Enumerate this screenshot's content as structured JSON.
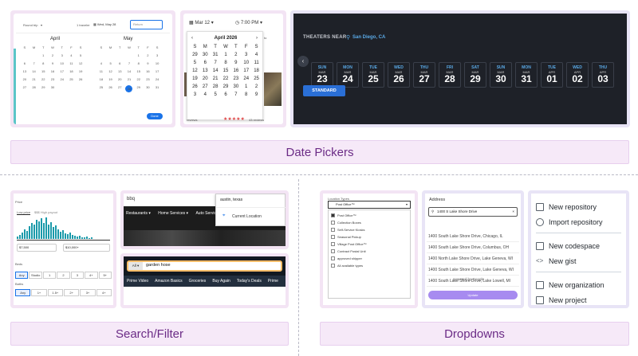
{
  "sections": {
    "date_pickers": "Date Pickers",
    "search_filter": "Search/Filter",
    "dropdowns": "Dropdowns"
  },
  "flight_picker": {
    "trip_type": "Round trip",
    "travelers": "1 traveler",
    "depart_value": "Wed, May 28",
    "return_placeholder": "Return",
    "month1": "April",
    "month2": "May",
    "weekdays": [
      "S",
      "M",
      "T",
      "W",
      "T",
      "F",
      "S"
    ],
    "april_days": [
      "",
      "",
      "1",
      "2",
      "3",
      "4",
      "5",
      "6",
      "7",
      "8",
      "9",
      "10",
      "11",
      "12",
      "13",
      "14",
      "15",
      "16",
      "17",
      "18",
      "19",
      "20",
      "21",
      "22",
      "23",
      "24",
      "25",
      "26",
      "27",
      "28",
      "29",
      "30",
      "",
      "",
      ""
    ],
    "may_days": [
      "",
      "",
      "",
      "",
      "1",
      "2",
      "3",
      "4",
      "5",
      "6",
      "7",
      "8",
      "9",
      "10",
      "11",
      "12",
      "13",
      "14",
      "15",
      "16",
      "17",
      "18",
      "19",
      "20",
      "21",
      "22",
      "23",
      "24",
      "25",
      "26",
      "27",
      "28",
      "29",
      "30",
      "31"
    ],
    "selected_day": "28",
    "done_label": "Done"
  },
  "event_picker": {
    "date_value": "Mar 12",
    "time_value": "7:00 PM",
    "month_title": "April 2026",
    "weekdays": [
      "S",
      "M",
      "T",
      "W",
      "T",
      "F",
      "S"
    ],
    "days": [
      "29",
      "30",
      "31",
      "1",
      "2",
      "3",
      "4",
      "5",
      "6",
      "7",
      "8",
      "9",
      "10",
      "11",
      "12",
      "13",
      "14",
      "15",
      "16",
      "17",
      "18",
      "19",
      "20",
      "21",
      "22",
      "23",
      "24",
      "25",
      "26",
      "27",
      "28",
      "29",
      "30",
      "1",
      "2",
      "3",
      "4",
      "5",
      "6",
      "7",
      "8",
      "9"
    ],
    "side_text": "to",
    "reviews_left": "reviews",
    "reviews_right": "43 reviews"
  },
  "theater_picker": {
    "label": "THEATERS NEAR",
    "location": "San Diego, CA",
    "days": [
      {
        "dn": "SUN",
        "mo": "MAR",
        "nm": "23"
      },
      {
        "dn": "MON",
        "mo": "MAR",
        "nm": "24"
      },
      {
        "dn": "TUE",
        "mo": "MAR",
        "nm": "25"
      },
      {
        "dn": "WED",
        "mo": "MAR",
        "nm": "26"
      },
      {
        "dn": "THU",
        "mo": "MAR",
        "nm": "27"
      },
      {
        "dn": "FRI",
        "mo": "MAR",
        "nm": "28"
      },
      {
        "dn": "SAT",
        "mo": "MAR",
        "nm": "29"
      },
      {
        "dn": "SUN",
        "mo": "MAR",
        "nm": "30"
      },
      {
        "dn": "MON",
        "mo": "MAR",
        "nm": "31"
      },
      {
        "dn": "TUE",
        "mo": "APR",
        "nm": "01"
      },
      {
        "dn": "WED",
        "mo": "APR",
        "nm": "02"
      },
      {
        "dn": "THU",
        "mo": "APR",
        "nm": "03"
      }
    ],
    "format_button": "STANDARD"
  },
  "price_filter": {
    "tab1": "Low price",
    "tab2": "$$$ High payout",
    "min_value": "$7,500",
    "max_value": "$10,000+",
    "beds_label": "Beds",
    "bath_label": "Baths",
    "beds_options": [
      "Any",
      "Studio",
      "1",
      "2",
      "3",
      "4+",
      "5+"
    ],
    "bath_options": [
      "Any",
      "1+",
      "1.5+",
      "2+",
      "3+",
      "4+"
    ]
  },
  "bbq_search": {
    "query": "bbq",
    "location_value": "austin, texas",
    "location_option": "Current Location",
    "nav": [
      "Restaurants",
      "Home Services",
      "Auto Services"
    ]
  },
  "amazon_search": {
    "category": "All",
    "query": "garden hose",
    "nav": [
      "Prime Video",
      "Amazon Basics",
      "Groceries",
      "Buy Again",
      "Today's Deals",
      "Prime"
    ]
  },
  "service_dropdown": {
    "selected": "Post Office™",
    "options": [
      "Post Office™",
      "Collection Boxes",
      "Self-Service Kiosks",
      "Seasonal Pickup",
      "Village Post Office™",
      "Contract Postal Unit",
      "approved shipper",
      "All available types"
    ]
  },
  "address_dropdown": {
    "label": "Address",
    "query": "1400 S Lake Shore Drive",
    "results": [
      "1400 South Lake Shore Drive, Chicago, IL",
      "1400 South Lake Shore Drive, Columbus, OH",
      "1400 North Lake Shore Drive, Lake Geneva, WI",
      "1400 South Lake Shore Drive, Lake Geneva, WI",
      "1400 South Lake Shore Drive, Lake Lowell, MI"
    ],
    "powered_by": "powered by Google",
    "button": "Update"
  },
  "github_menu": {
    "items": [
      {
        "label": "New repository",
        "icon": "repo-icon"
      },
      {
        "label": "Import repository",
        "icon": "upload-icon"
      },
      {
        "label": "New codespace",
        "icon": "codespace-icon"
      },
      {
        "label": "New gist",
        "icon": "code-icon"
      },
      {
        "label": "New organization",
        "icon": "organization-icon"
      },
      {
        "label": "New project",
        "icon": "project-icon"
      }
    ]
  },
  "colors": {
    "banner_bg": "#f6e9f8",
    "banner_text": "#6b2b86",
    "accent_blue": "#1a73e8",
    "theater_bg": "#1e2128",
    "theater_accent": "#5aa9e6",
    "standard_button": "#2a6fd6",
    "update_button": "#a78bf0"
  }
}
